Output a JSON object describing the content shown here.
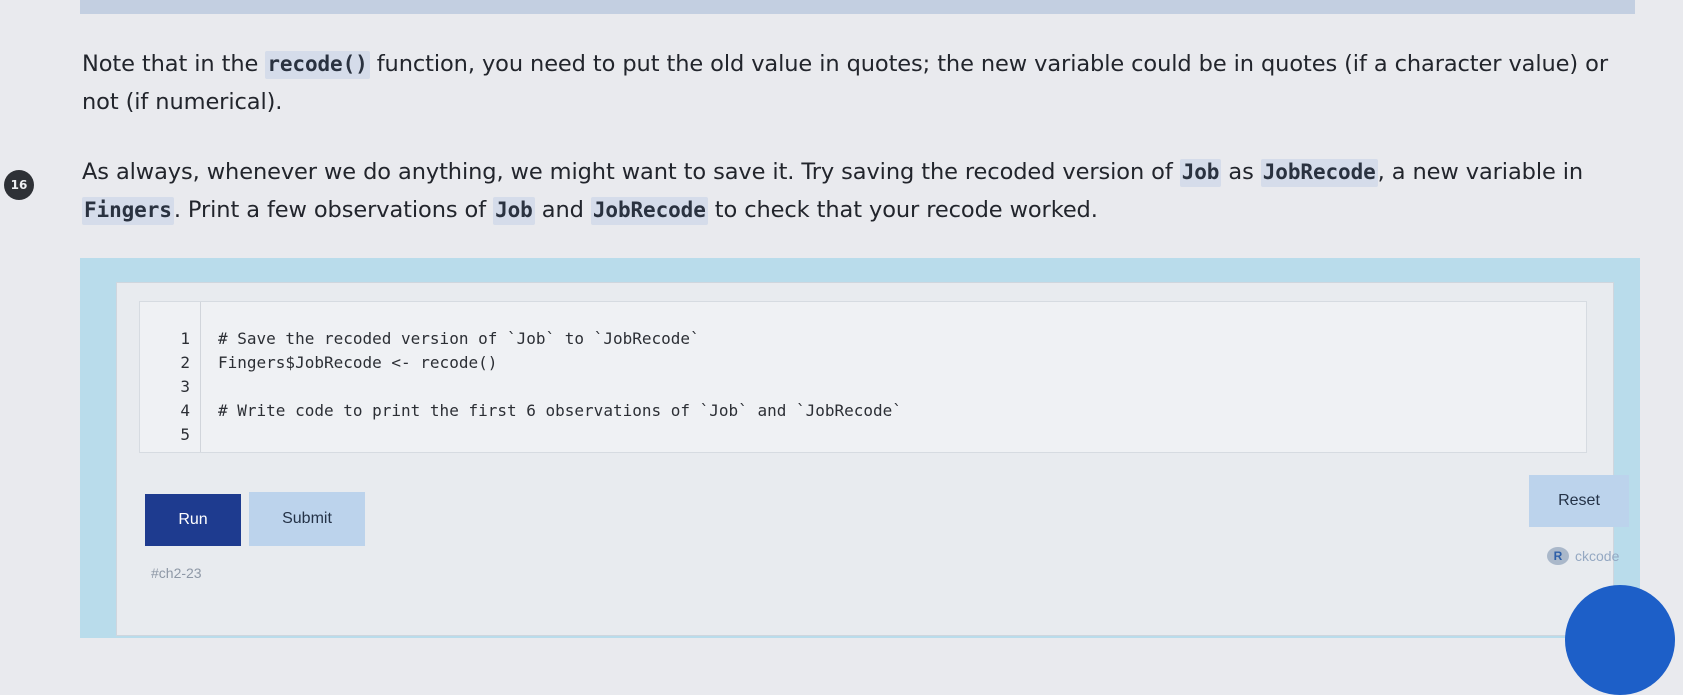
{
  "step": {
    "number": "16"
  },
  "paragraph1": {
    "part1": "Note that in the ",
    "code1": "recode()",
    "part2": " function, you need to put the old value in quotes; the new variable could be in quotes (if a character value) or not (if numerical)."
  },
  "paragraph2": {
    "part1": "As always, whenever we do anything, we might want to save it. Try saving the recoded version of ",
    "code1": "Job",
    "part2": " as ",
    "code2": "JobRecode",
    "part3": ", a new variable in ",
    "code3": "Fingers",
    "part4": ". Print a few observations of ",
    "code4": "Job",
    "part5": " and ",
    "code5": "JobRecode",
    "part6": " to check that your recode worked."
  },
  "editor": {
    "lines": [
      {
        "number": "1",
        "text": "# Save the recoded version of `Job` to `JobRecode`"
      },
      {
        "number": "2",
        "text": "Fingers$JobRecode <- recode()"
      },
      {
        "number": "3",
        "text": ""
      },
      {
        "number": "4",
        "text": "# Write code to print the first 6 observations of `Job` and `JobRecode`"
      },
      {
        "number": "5",
        "text": ""
      }
    ]
  },
  "buttons": {
    "run": "Run",
    "submit": "Submit",
    "reset": "Reset"
  },
  "exercise_label": "#ch2-23",
  "powered_by": {
    "logo_text": "R",
    "text": "ckcode"
  },
  "colors": {
    "run_button": "#1e3b8f",
    "secondary_button": "#bcd3ec",
    "exercise_border": "#b9dceb"
  }
}
